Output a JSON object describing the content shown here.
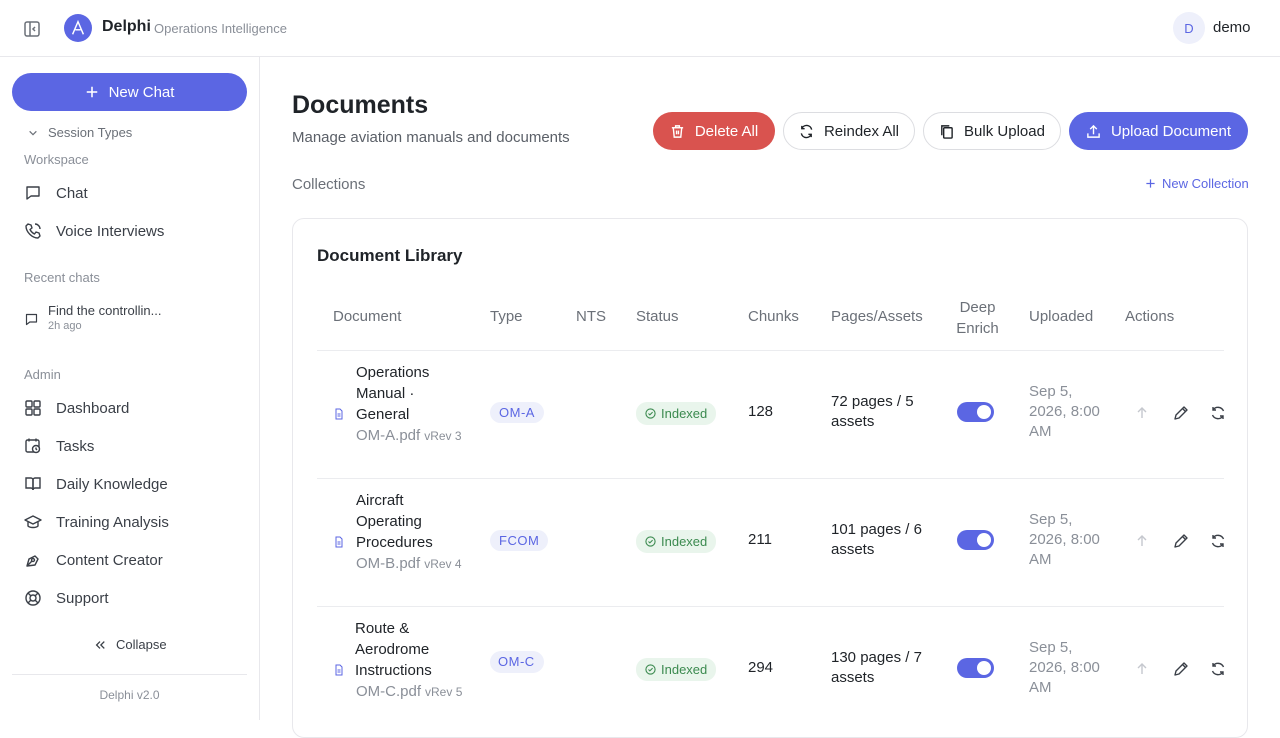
{
  "header": {
    "app_name": "Delphi",
    "app_subtitle": "Operations Intelligence",
    "user_initial": "D",
    "user_name": "demo"
  },
  "sidebar": {
    "new_chat_label": "New Chat",
    "session_types_label": "Session Types",
    "workspace_label": "Workspace",
    "workspace_items": [
      {
        "label": "Chat",
        "icon": "chat-icon"
      },
      {
        "label": "Voice Interviews",
        "icon": "phone-icon"
      }
    ],
    "recent_label": "Recent chats",
    "recent_chats": [
      {
        "title": "Find the controllin...",
        "time": "2h ago"
      }
    ],
    "admin_label": "Admin",
    "admin_items": [
      {
        "label": "Dashboard",
        "icon": "dashboard-icon"
      },
      {
        "label": "Tasks",
        "icon": "calendar-clock-icon"
      },
      {
        "label": "Daily Knowledge",
        "icon": "book-icon"
      },
      {
        "label": "Training Analysis",
        "icon": "graduation-cap-icon"
      },
      {
        "label": "Content Creator",
        "icon": "pen-tool-icon"
      },
      {
        "label": "Support",
        "icon": "lifebuoy-icon"
      }
    ],
    "collapse_label": "Collapse",
    "version": "Delphi v2.0"
  },
  "main": {
    "title": "Documents",
    "subtitle": "Manage aviation manuals and documents",
    "buttons": {
      "delete_all": "Delete All",
      "reindex_all": "Reindex All",
      "bulk_upload": "Bulk Upload",
      "upload_document": "Upload Document"
    },
    "collections_label": "Collections",
    "new_collection_label": "New Collection",
    "library": {
      "title": "Document Library",
      "columns": [
        "Document",
        "Type",
        "NTS",
        "Status",
        "Chunks",
        "Pages/Assets",
        "Deep Enrich",
        "Uploaded",
        "Actions"
      ],
      "rows": [
        {
          "title": "Operations Manual · General",
          "file": "OM-A.pdf",
          "rev": "vRev 3",
          "type": "OM-A",
          "nts": "",
          "status": "Indexed",
          "chunks": "128",
          "pages": "72 pages / 5 assets",
          "deep_enrich": true,
          "uploaded": "Sep 5, 2026, 8:00 AM"
        },
        {
          "title": "Aircraft Operating Procedures",
          "file": "OM-B.pdf",
          "rev": "vRev 4",
          "type": "FCOM",
          "nts": "",
          "status": "Indexed",
          "chunks": "211",
          "pages": "101 pages / 6 assets",
          "deep_enrich": true,
          "uploaded": "Sep 5, 2026, 8:00 AM"
        },
        {
          "title": "Route & Aerodrome Instructions",
          "file": "OM-C.pdf",
          "rev": "vRev 5",
          "type": "OM-C",
          "nts": "",
          "status": "Indexed",
          "chunks": "294",
          "pages": "130 pages / 7 assets",
          "deep_enrich": true,
          "uploaded": "Sep 5, 2026, 8:00 AM"
        }
      ]
    }
  },
  "colors": {
    "accent": "#5b66e3",
    "danger": "#d9534f",
    "success": "#3b8a4f"
  }
}
